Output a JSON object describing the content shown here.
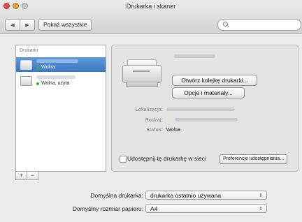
{
  "window": {
    "title": "Drukarka i skaner"
  },
  "toolbar": {
    "back": "◀",
    "forward": "▶",
    "show_all": "Pokaż wszystkie"
  },
  "printers": {
    "header": "Drukarki",
    "items": [
      {
        "status": "Wolna",
        "selected": true
      },
      {
        "status": "Wolna, użyta",
        "selected": false
      }
    ],
    "add": "+",
    "remove": "−"
  },
  "details": {
    "open_queue": "Otwórz kolejkę drukarki...",
    "options": "Opcje i materiały...",
    "location_label": "Lokalizacja:",
    "kind_label": "Rodzaj:",
    "status_label": "Status:",
    "status_value": "Wolna",
    "share_label": "Udostępnij tę drukarkę w sieci",
    "share_prefs": "Preferencje udostępniania..."
  },
  "defaults": {
    "printer_label": "Domyślna drukarka:",
    "printer_value": "drukarka ostatnio używana",
    "paper_label": "Domyślny rozmiar papieru:",
    "paper_value": "A4",
    "arrows": "⇕"
  }
}
